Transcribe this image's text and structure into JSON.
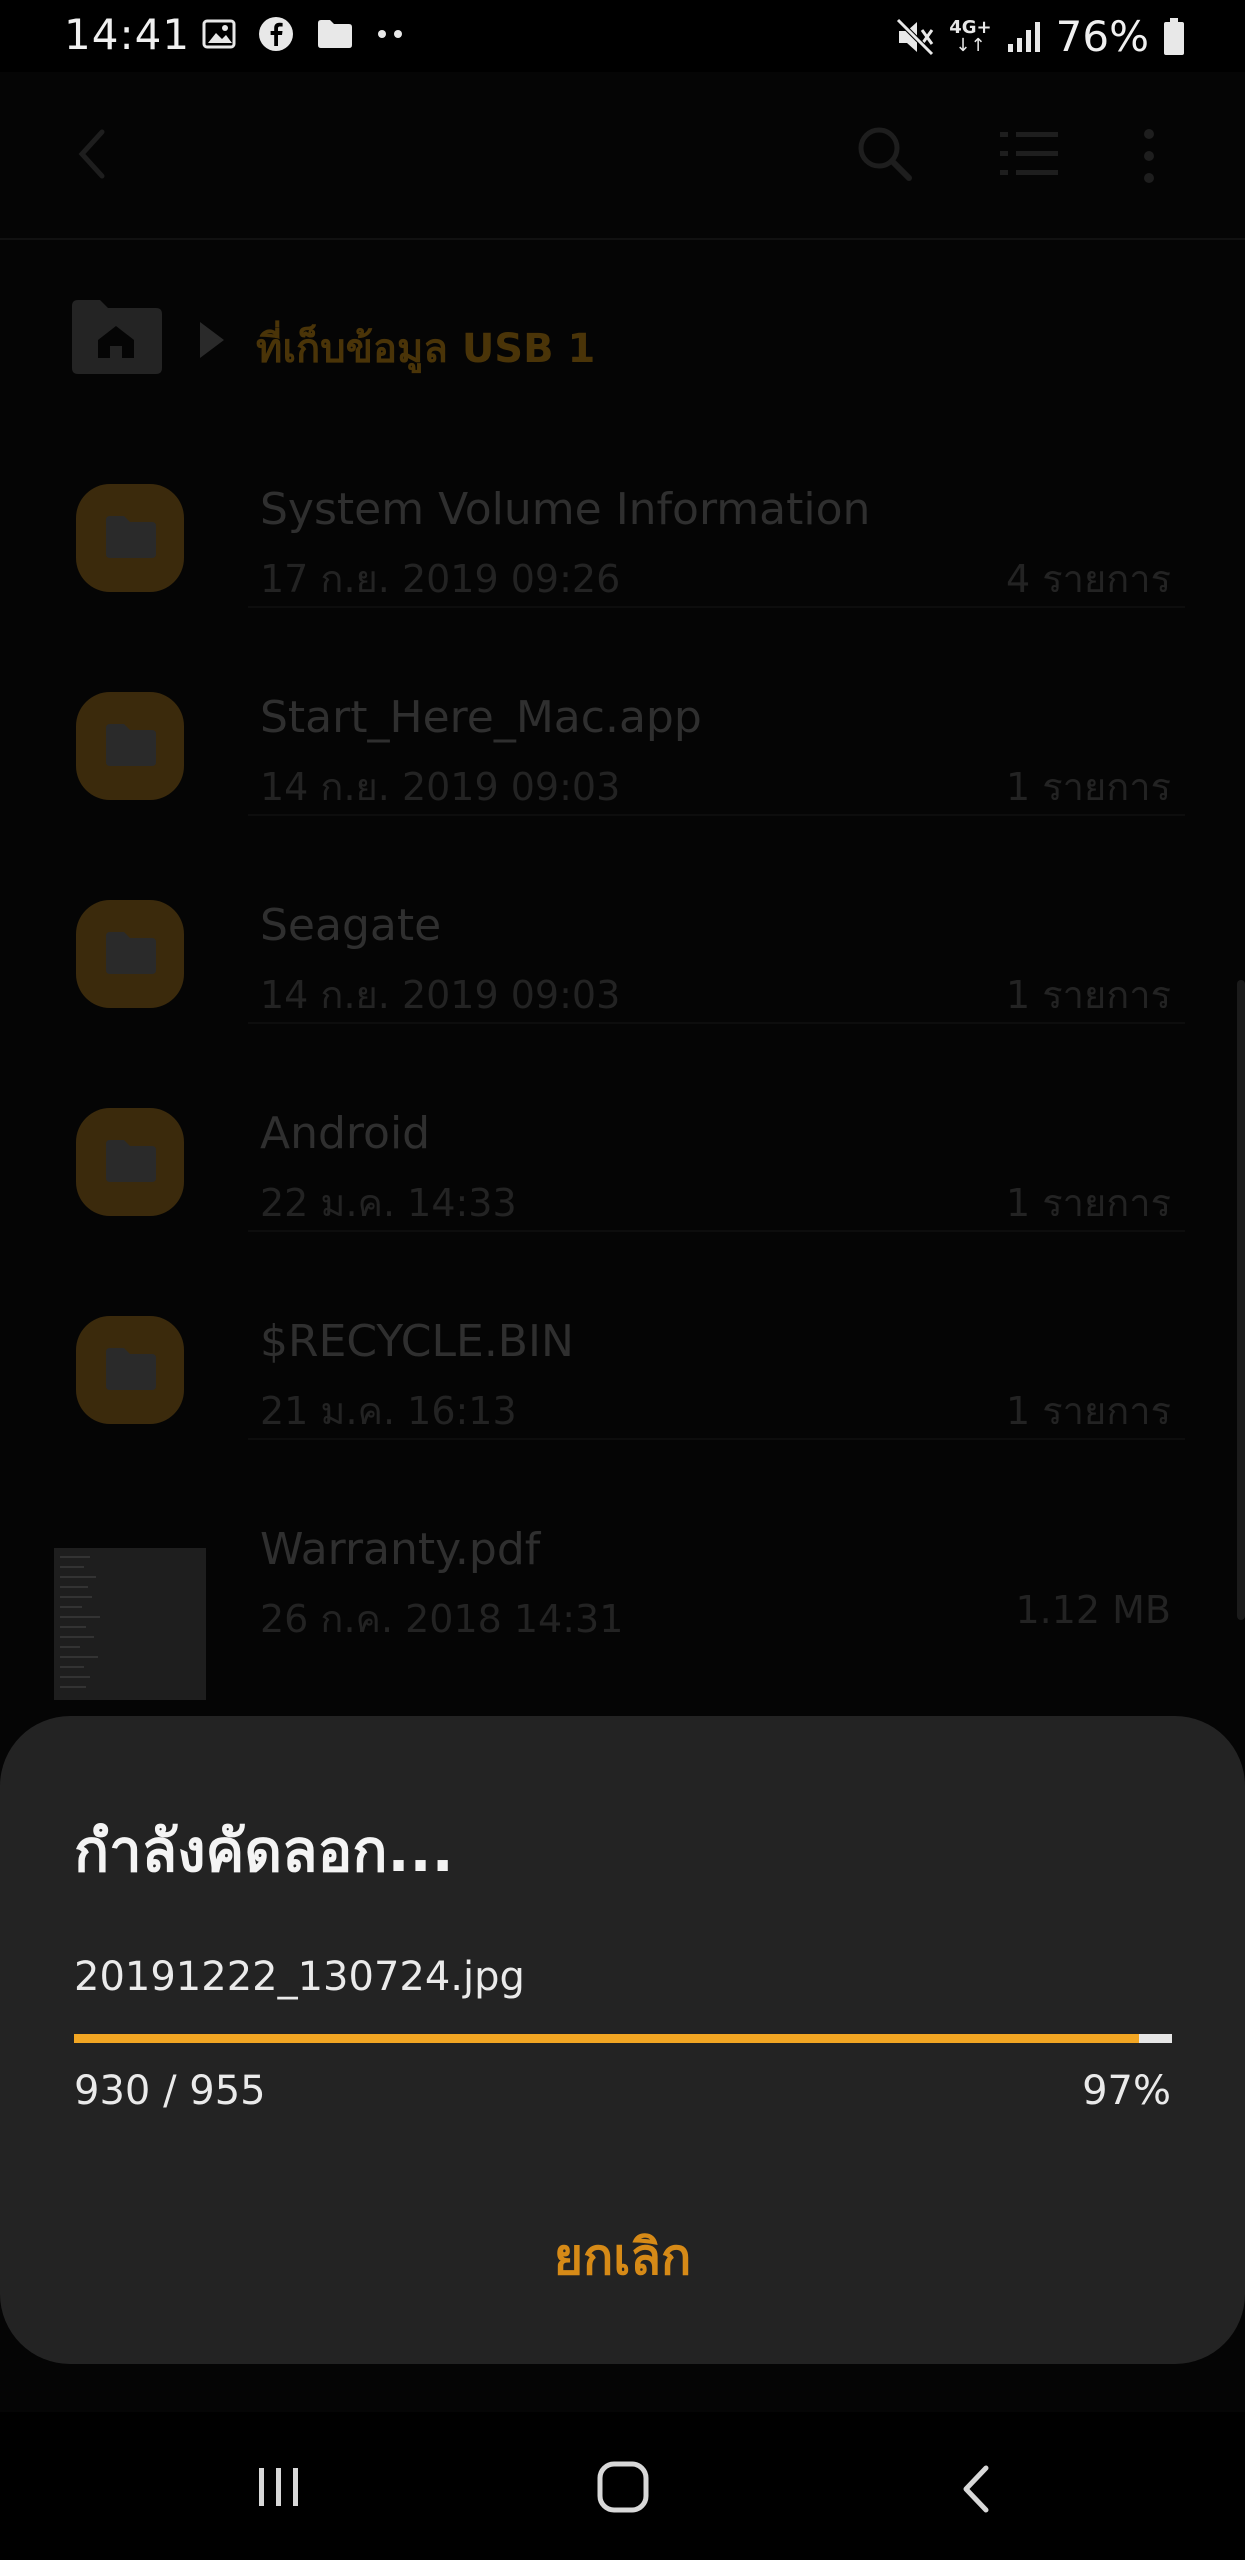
{
  "status_bar": {
    "time": "14:41",
    "network": "4G+",
    "battery": "76%",
    "left_icons": [
      "gallery-icon",
      "facebook-icon",
      "folder-icon",
      "more-dots-icon"
    ],
    "right_icons": [
      "mute-icon",
      "network-4g-icon",
      "signal-icon",
      "battery-icon"
    ]
  },
  "app_bar": {
    "icons": [
      "back-arrow-icon",
      "search-icon",
      "list-view-icon",
      "more-options-icon"
    ]
  },
  "breadcrumb": {
    "label": "ที่เก็บข้อมูล USB 1"
  },
  "files": [
    {
      "name": "System Volume Information",
      "date": "17 ก.ย. 2019 09:26",
      "count": "4 รายการ",
      "type": "folder"
    },
    {
      "name": "Start_Here_Mac.app",
      "date": "14 ก.ย. 2019 09:03",
      "count": "1 รายการ",
      "type": "folder"
    },
    {
      "name": "Seagate",
      "date": "14 ก.ย. 2019 09:03",
      "count": "1 รายการ",
      "type": "folder"
    },
    {
      "name": "Android",
      "date": "22 ม.ค. 14:33",
      "count": "1 รายการ",
      "type": "folder"
    },
    {
      "name": "$RECYCLE.BIN",
      "date": "21 ม.ค. 16:13",
      "count": "1 รายการ",
      "type": "folder"
    },
    {
      "name": "Warranty.pdf",
      "date": "26 ก.ค. 2018 14:31",
      "count": "1.12 MB",
      "type": "pdf"
    }
  ],
  "dialog": {
    "title": "กำลังคัดลอก...",
    "filename": "20191222_130724.jpg",
    "progress_count": "930 / 955",
    "progress_percent": "97%",
    "progress_fraction": 0.97,
    "cancel_label": "ยกเลิก"
  },
  "colors": {
    "accent": "#f2a623",
    "cancel": "#d68a17",
    "dialog_bg": "#232323"
  }
}
